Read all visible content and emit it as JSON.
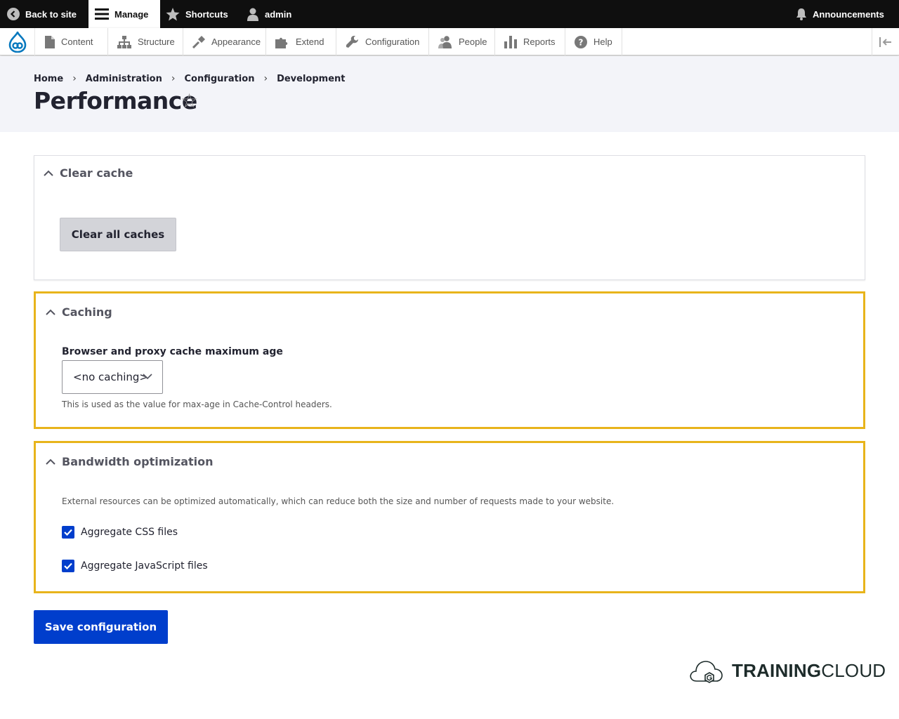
{
  "toolbar": {
    "back_label": "Back to site",
    "manage_label": "Manage",
    "shortcuts_label": "Shortcuts",
    "user_label": "admin",
    "announcements_label": "Announcements"
  },
  "tray": {
    "items": [
      {
        "label": "Content",
        "icon": "content-icon"
      },
      {
        "label": "Structure",
        "icon": "structure-icon"
      },
      {
        "label": "Appearance",
        "icon": "appearance-icon"
      },
      {
        "label": "Extend",
        "icon": "extend-icon"
      },
      {
        "label": "Configuration",
        "icon": "wrench-icon"
      },
      {
        "label": "People",
        "icon": "people-icon"
      },
      {
        "label": "Reports",
        "icon": "reports-icon"
      },
      {
        "label": "Help",
        "icon": "help-icon"
      }
    ]
  },
  "breadcrumb": [
    "Home",
    "Administration",
    "Configuration",
    "Development"
  ],
  "page": {
    "title": "Performance"
  },
  "clear_cache": {
    "summary": "Clear cache",
    "button": "Clear all caches"
  },
  "caching": {
    "summary": "Caching",
    "label": "Browser and proxy cache maximum age",
    "selected": "<no caching>",
    "description": "This is used as the value for max-age in Cache-Control headers."
  },
  "bandwidth": {
    "summary": "Bandwidth optimization",
    "description": "External resources can be optimized automatically, which can reduce both the size and number of requests made to your website.",
    "options": [
      {
        "label": "Aggregate CSS files",
        "checked": true
      },
      {
        "label": "Aggregate JavaScript files",
        "checked": true
      }
    ]
  },
  "actions": {
    "save": "Save configuration"
  },
  "brand": {
    "bold": "TRAINING",
    "light": "CLOUD"
  },
  "colors": {
    "toolbar": "#0f0f0f",
    "header_bg": "#f3f4f9",
    "highlight_border": "#e8b41b",
    "primary": "#003ecc",
    "drupal_blue": "#0678be"
  }
}
